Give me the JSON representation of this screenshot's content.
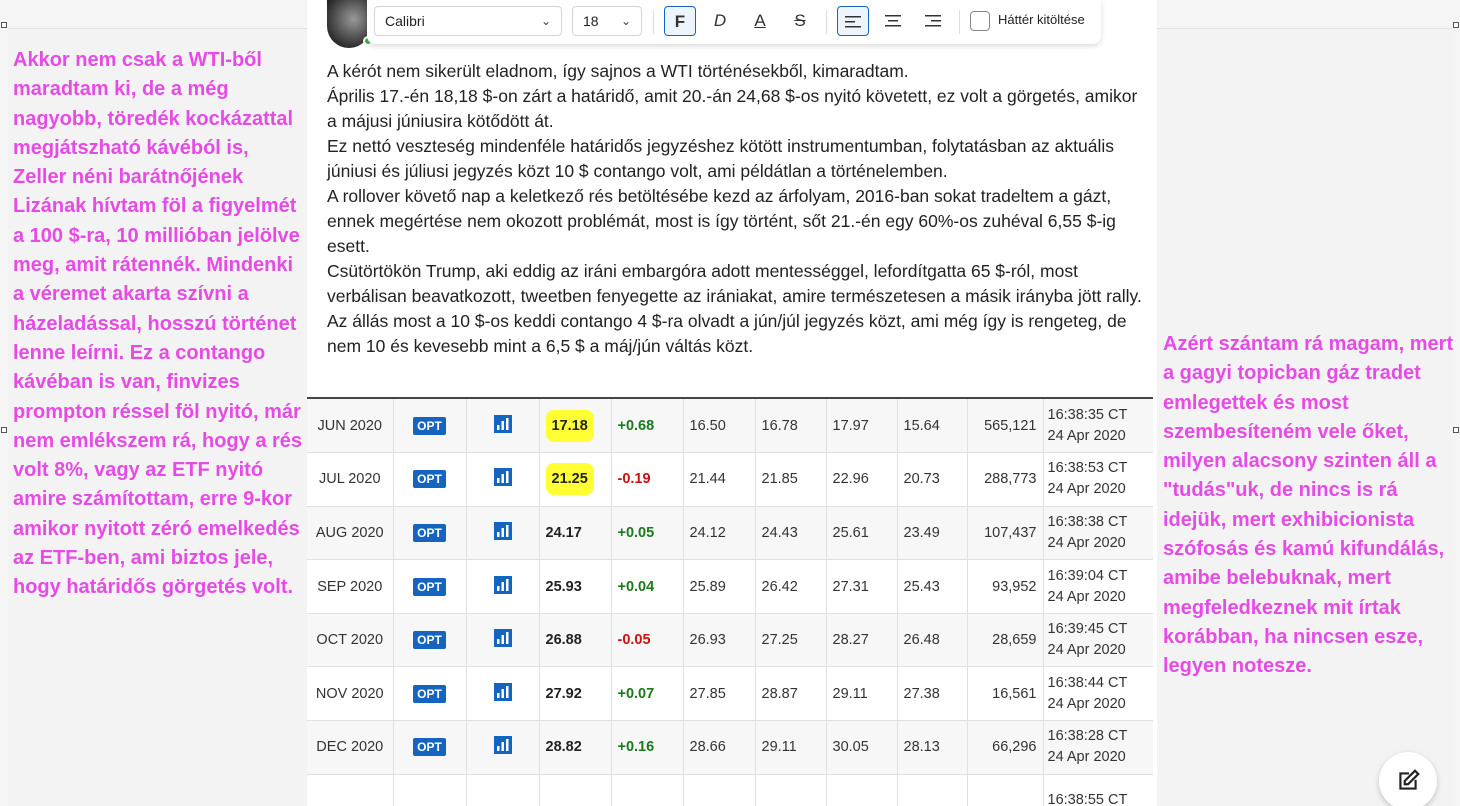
{
  "toolbar": {
    "font_family": "Calibri",
    "font_size": "18",
    "bold_label": "F",
    "italic_label": "D",
    "underline_label": "A",
    "strike_label": "S",
    "fill_background_label": "Háttér kitöltése"
  },
  "left_note": "Akkor nem csak a WTI-ből maradtam ki, de a még nagyobb, töredék kockázattal megjátszható kávéból is, Zeller néni barátnőjének Lizának hívtam föl a figyelmét a 100 $-ra, 10 millióban jelölve meg, amit rátennék. Mindenki a véremet akarta szívni a házeladással, hosszú történet lenne leírni. Ez a contango kávéban is van, finvizes prompton réssel föl nyitó, már nem emlékszem rá, hogy a rés volt 8%, vagy az ETF nyitó amire számítottam, erre 9-kor amikor nyitott zéró emelkedés az ETF-ben, ami biztos jele, hogy határidős görgetés volt.",
  "right_note": "Azért szántam rá magam, mert a gagyi topicban gáz tradet emlegettek és most szembesíteném vele őket, milyen alacsony szinten áll a \"tudás\"uk, de nincs is rá idejük, mert exhibicionista szófosás és kamú kifundálás, amibe belebuknak, mert megfeledkeznek mit írtak korábban, ha nincsen esze, legyen notesze.",
  "post": {
    "paragraphs": [
      "A kérót nem sikerült eladnom, így sajnos a WTI történésekből, kimaradtam.",
      "Április 17.-én 18,18 $-on zárt a határidő, amit 20.-án 24,68 $-os nyitó követett, ez volt a görgetés, amikor a májusi júniusira kötődött át.",
      "Ez nettó veszteség mindenféle határidős jegyzéshez kötött instrumentumban, folytatásban az aktuális júniusi és júliusi jegyzés közt 10 $ contango volt, ami példátlan a történelemben.",
      "A rollover követő nap a keletkező rés betöltésébe kezd az árfolyam, 2016-ban sokat tradeltem a gázt, ennek megértése  nem okozott problémát,  most is így történt, sőt 21.-én egy 60%-os zuhéval 6,55 $-ig esett.",
      "Csütörtökön Trump, aki eddig az iráni embargóra adott mentességgel, lefordítgatta 65 $-ról, most verbálisan beavatkozott, tweetben fenyegette az irániakat, amire természetesen a másik irányba jött rally.",
      "Az állás most a 10 $-os keddi contango 4 $-ra olvadt a jún/júl jegyzés közt, ami még így is rengeteg, de nem 10 és kevesebb mint a 6,5 $ a máj/jún váltás közt."
    ]
  },
  "table": {
    "opt_label": "OPT",
    "rows": [
      {
        "month": "JUN 2020",
        "last": "17.18",
        "change": "+0.68",
        "open": "16.50",
        "prev": "16.78",
        "high": "17.97",
        "low": "15.64",
        "volume": "565,121",
        "time": "16:38:35 CT",
        "date": "24 Apr 2020",
        "highlight": true
      },
      {
        "month": "JUL 2020",
        "last": "21.25",
        "change": "-0.19",
        "open": "21.44",
        "prev": "21.85",
        "high": "22.96",
        "low": "20.73",
        "volume": "288,773",
        "time": "16:38:53 CT",
        "date": "24 Apr 2020",
        "highlight": true
      },
      {
        "month": "AUG 2020",
        "last": "24.17",
        "change": "+0.05",
        "open": "24.12",
        "prev": "24.43",
        "high": "25.61",
        "low": "23.49",
        "volume": "107,437",
        "time": "16:38:38 CT",
        "date": "24 Apr 2020",
        "highlight": false
      },
      {
        "month": "SEP 2020",
        "last": "25.93",
        "change": "+0.04",
        "open": "25.89",
        "prev": "26.42",
        "high": "27.31",
        "low": "25.43",
        "volume": "93,952",
        "time": "16:39:04 CT",
        "date": "24 Apr 2020",
        "highlight": false
      },
      {
        "month": "OCT 2020",
        "last": "26.88",
        "change": "-0.05",
        "open": "26.93",
        "prev": "27.25",
        "high": "28.27",
        "low": "26.48",
        "volume": "28,659",
        "time": "16:39:45 CT",
        "date": "24 Apr 2020",
        "highlight": false
      },
      {
        "month": "NOV 2020",
        "last": "27.92",
        "change": "+0.07",
        "open": "27.85",
        "prev": "28.87",
        "high": "29.11",
        "low": "27.38",
        "volume": "16,561",
        "time": "16:38:44 CT",
        "date": "24 Apr 2020",
        "highlight": false
      },
      {
        "month": "DEC 2020",
        "last": "28.82",
        "change": "+0.16",
        "open": "28.66",
        "prev": "29.11",
        "high": "30.05",
        "low": "28.13",
        "volume": "66,296",
        "time": "16:38:28 CT",
        "date": "24 Apr 2020",
        "highlight": false
      },
      {
        "month": "",
        "last": "",
        "change": "",
        "open": "",
        "prev": "",
        "high": "",
        "low": "",
        "volume": "",
        "time": "16:38:55 CT",
        "date": "",
        "highlight": false
      }
    ]
  },
  "colors": {
    "accent": "#1565c0",
    "note_text": "#e64be6",
    "positive": "#1b7a1b",
    "negative": "#cc1111",
    "highlight": "#ffff33"
  }
}
